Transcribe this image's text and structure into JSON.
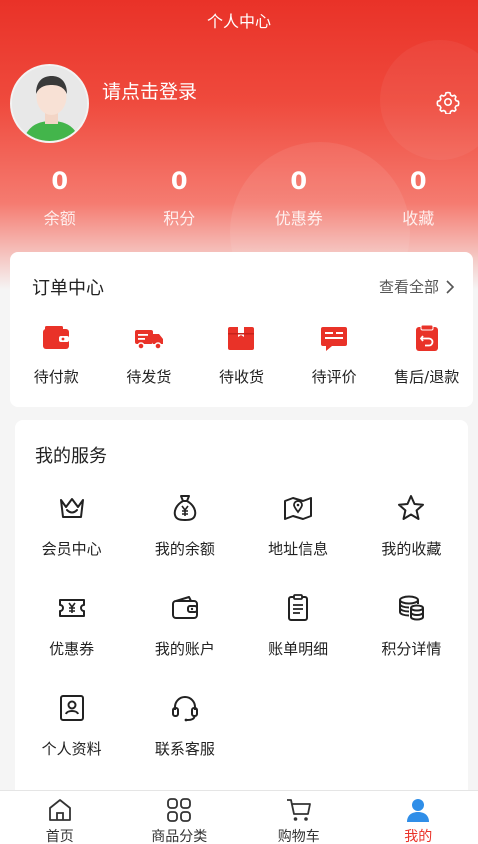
{
  "header": {
    "title": "个人中心"
  },
  "profile": {
    "login_prompt": "请点击登录",
    "avatar_icon": "user-avatar",
    "settings_icon": "gear-icon"
  },
  "stats": [
    {
      "value": "0",
      "label": "余额"
    },
    {
      "value": "0",
      "label": "积分"
    },
    {
      "value": "0",
      "label": "优惠券"
    },
    {
      "value": "0",
      "label": "收藏"
    }
  ],
  "orders": {
    "title": "订单中心",
    "view_all": "查看全部",
    "items": [
      {
        "label": "待付款",
        "icon": "wallet-icon"
      },
      {
        "label": "待发货",
        "icon": "truck-icon"
      },
      {
        "label": "待收货",
        "icon": "box-icon"
      },
      {
        "label": "待评价",
        "icon": "comment-icon"
      },
      {
        "label": "售后/退款",
        "icon": "refund-icon"
      }
    ]
  },
  "services": {
    "title": "我的服务",
    "items": [
      {
        "label": "会员中心",
        "icon": "crown-icon"
      },
      {
        "label": "我的余额",
        "icon": "money-bag-icon"
      },
      {
        "label": "地址信息",
        "icon": "map-icon"
      },
      {
        "label": "我的收藏",
        "icon": "star-icon"
      },
      {
        "label": "优惠券",
        "icon": "coupon-icon"
      },
      {
        "label": "我的账户",
        "icon": "wallet-outline-icon"
      },
      {
        "label": "账单明细",
        "icon": "clipboard-icon"
      },
      {
        "label": "积分详情",
        "icon": "coins-icon"
      },
      {
        "label": "个人资料",
        "icon": "profile-card-icon"
      },
      {
        "label": "联系客服",
        "icon": "headset-icon"
      }
    ]
  },
  "tabbar": {
    "items": [
      {
        "label": "首页",
        "icon": "home-icon"
      },
      {
        "label": "商品分类",
        "icon": "category-grid-icon"
      },
      {
        "label": "购物车",
        "icon": "cart-icon"
      },
      {
        "label": "我的",
        "icon": "person-icon",
        "active": true
      }
    ]
  },
  "colors": {
    "accent": "#e93228",
    "header_top": "#e93228",
    "header_mid": "#f57b70"
  }
}
